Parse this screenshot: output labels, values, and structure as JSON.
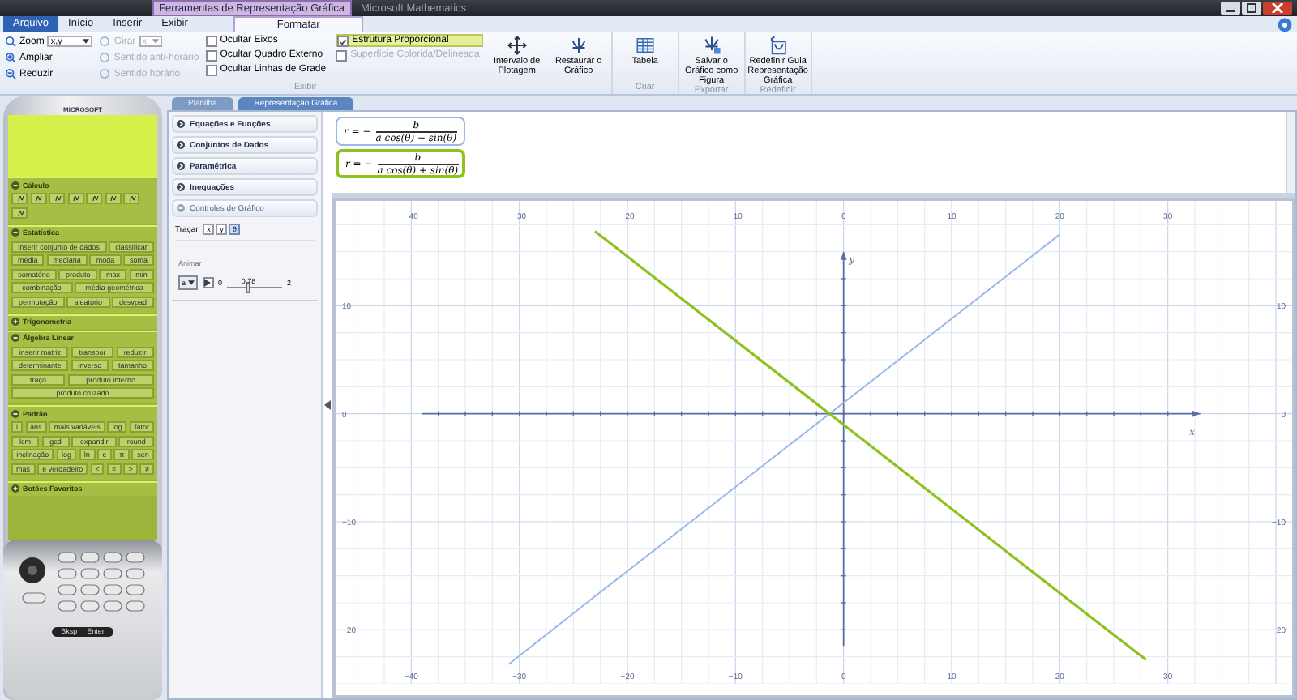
{
  "window": {
    "context_label": "Ferramentas de Representação Gráfica",
    "title": "Microsoft Mathematics"
  },
  "ribbon_tabs": [
    {
      "label": "Arquivo",
      "kind": "file",
      "selected": false
    },
    {
      "label": "Início",
      "kind": "tab",
      "selected": false
    },
    {
      "label": "Inserir",
      "kind": "tab",
      "selected": false
    },
    {
      "label": "Exibir",
      "kind": "tab",
      "selected": false
    },
    {
      "label": "Formatar",
      "kind": "tab",
      "selected": true
    }
  ],
  "ribbon": {
    "zoom": {
      "label": "Zoom",
      "value": "x,y"
    },
    "zoom_in": "Ampliar",
    "zoom_out": "Reduzir",
    "rotate": {
      "label": "Girar",
      "value": "x",
      "disabled": true
    },
    "rotate_buttons": [
      {
        "label": "Sentido anti-horário",
        "disabled": true
      },
      {
        "label": "Sentido horário",
        "disabled": true
      }
    ],
    "checkboxes": [
      {
        "label": "Ocultar Eixos",
        "checked": false,
        "disabled": false,
        "selected": false
      },
      {
        "label": "Ocultar Quadro Externo",
        "checked": false,
        "disabled": false,
        "selected": false
      },
      {
        "label": "Ocultar Linhas de Grade",
        "checked": false,
        "disabled": false,
        "selected": false
      },
      {
        "label": "Estrutura Proporcional",
        "checked": true,
        "disabled": false,
        "selected": true
      },
      {
        "label": "Superfície Colorida/Delineada",
        "checked": false,
        "disabled": true,
        "selected": false
      }
    ],
    "view_buttons": [
      "Intervalo de Plotagem",
      "Restaurar o Gráfico"
    ],
    "groups": [
      {
        "label": "Exibir"
      },
      {
        "label": "Criar",
        "button": "Tabela"
      },
      {
        "label": "Exportar",
        "button": "Salvar o Gráfico como Figura"
      },
      {
        "label": "Redefinir",
        "button": "Redefinir Guia Representação Gráfica"
      }
    ]
  },
  "calculator": {
    "brand": "MICROSOFT",
    "sections": [
      {
        "title": "Cálculo",
        "expanded": true,
        "kind": "icons"
      },
      {
        "title": "Estatística",
        "expanded": true,
        "kind": "keys",
        "buttons": [
          "inserir conjunto de dados",
          "classificar",
          "média",
          "mediana",
          "moda",
          "soma",
          "somatório",
          "produto",
          "max",
          "min",
          "combinação",
          "média geométrica",
          "permutação",
          "aleatório",
          "desvpad"
        ]
      },
      {
        "title": "Trigonometria",
        "expanded": false
      },
      {
        "title": "Álgebra Linear",
        "expanded": true,
        "kind": "keys",
        "buttons": [
          "inserir matriz",
          "transpor",
          "reduzir",
          "determinante",
          "inverso",
          "tamanho",
          "traço",
          "produto interno",
          "produto cruzado"
        ]
      },
      {
        "title": "Padrão",
        "expanded": true,
        "kind": "keys",
        "buttons": [
          "i",
          "ans",
          "mais variáveis",
          "log",
          "fator",
          "lcm",
          "gcd",
          "expandir",
          "round",
          "inclinação",
          "log",
          "ln",
          "e",
          "π",
          "sen",
          "mas",
          "é verdadeiro",
          "<",
          "=",
          ">",
          "≠"
        ]
      },
      {
        "title": "Botões Favoritos",
        "expanded": false
      }
    ],
    "keys": [
      "Bksp",
      "Enter"
    ]
  },
  "doc_tabs": [
    {
      "label": "Planilha",
      "selected": false
    },
    {
      "label": "Representação Gráfica",
      "selected": true
    }
  ],
  "panel_items": [
    {
      "label": "Equações e Funções",
      "expanded": false
    },
    {
      "label": "Conjuntos de Dados",
      "expanded": false
    },
    {
      "label": "Paramétrica",
      "expanded": false
    },
    {
      "label": "Inequações",
      "expanded": false
    },
    {
      "label": "Controles de Gráfico",
      "expanded": true
    }
  ],
  "graph_controls": {
    "trace_label": "Traçar",
    "trace_buttons": [
      {
        "label": "x",
        "selected": false
      },
      {
        "label": "y",
        "selected": false
      },
      {
        "label": "θ",
        "selected": true
      }
    ],
    "animate_label": "Animar",
    "variable": "a",
    "min": "0",
    "value": "0.78",
    "max": "2",
    "level": 0.39
  },
  "equations": [
    {
      "lhs": "r = −",
      "numerator": "b",
      "denominator": "a cos(θ) − sin(θ)",
      "color": "#9ab8e8",
      "selected": false
    },
    {
      "lhs": "r = −",
      "numerator": "b",
      "denominator": "a cos(θ) + sin(θ)",
      "color": "#8dc21f",
      "selected": true
    }
  ],
  "graph": {
    "chart_data": {
      "type": "line",
      "grid": true,
      "xlabel": "x",
      "ylabel": "y",
      "x": [
        -31,
        -23,
        20,
        28
      ],
      "series": [
        {
          "color": "#9ab8e8",
          "values": [
            -23.2,
            -16.9,
            16.6,
            null
          ]
        },
        {
          "color": "#8dc21f",
          "values": [
            null,
            16.9,
            -16.6,
            -22.8
          ]
        }
      ],
      "xlim": [
        -47,
        41.5
      ],
      "ylim": [
        -25,
        19.7
      ],
      "xticks": [
        {
          "value": -40,
          "label": "−40"
        },
        {
          "value": -30,
          "label": "−30"
        },
        {
          "value": -20,
          "label": "−20"
        },
        {
          "value": -10,
          "label": "−10"
        },
        {
          "value": 0,
          "label": "0"
        },
        {
          "value": 10,
          "label": "10"
        },
        {
          "value": 20,
          "label": "20"
        },
        {
          "value": 30,
          "label": "30"
        }
      ],
      "yticks": [
        {
          "value": -20,
          "label": "−20"
        },
        {
          "value": -10,
          "label": "−10"
        },
        {
          "value": 0,
          "label": "0"
        },
        {
          "value": 10,
          "label": "10"
        }
      ]
    }
  }
}
